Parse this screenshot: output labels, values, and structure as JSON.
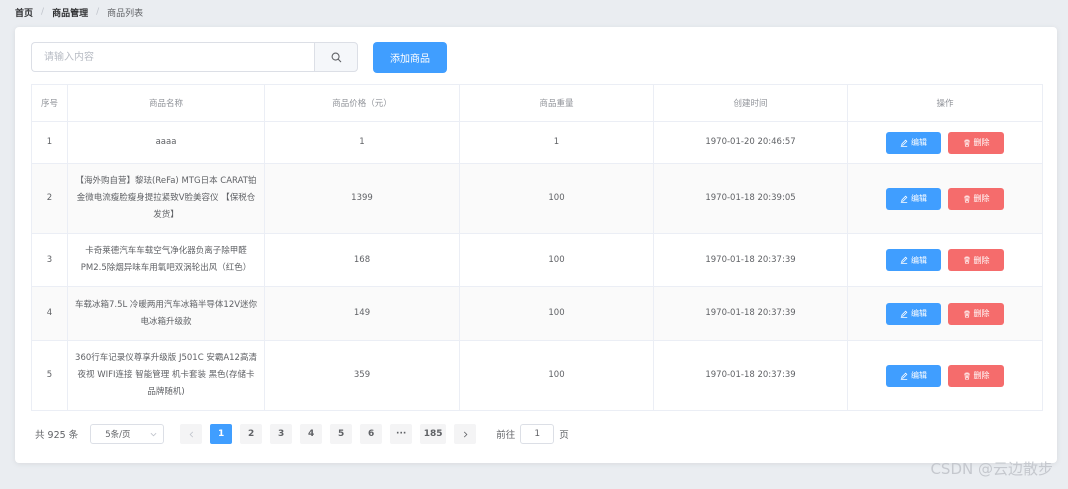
{
  "breadcrumb": {
    "home": "首页",
    "section": "商品管理",
    "current": "商品列表",
    "separator": "/"
  },
  "search": {
    "placeholder": "请输入内容",
    "value": "",
    "icon": "search-icon"
  },
  "toolbar": {
    "add_label": "添加商品"
  },
  "table": {
    "headers": [
      "序号",
      "商品名称",
      "商品价格（元）",
      "商品重量",
      "创建时间",
      "操作"
    ],
    "rows": [
      {
        "index": "1",
        "name": "aaaa",
        "price": "1",
        "weight": "1",
        "created": "1970-01-20 20:46:57"
      },
      {
        "index": "2",
        "name": "【海外购自营】黎珐(ReFa) MTG日本 CARAT铂金微电流瘦脸瘦身提拉紧致V脸美容仪 【保税仓发货】",
        "price": "1399",
        "weight": "100",
        "created": "1970-01-18 20:39:05"
      },
      {
        "index": "3",
        "name": "卡奇莱德汽车车载空气净化器负离子除甲醛PM2.5除烟异味车用氧吧双涡轮出风（红色）",
        "price": "168",
        "weight": "100",
        "created": "1970-01-18 20:37:39"
      },
      {
        "index": "4",
        "name": "车载冰箱7.5L 冷暖两用汽车冰箱半导体12V迷你电冰箱升级款",
        "price": "149",
        "weight": "100",
        "created": "1970-01-18 20:37:39"
      },
      {
        "index": "5",
        "name": "360行车记录仪尊享升级版 J501C 安霸A12高清夜视 WIFI连接 智能管理 机卡套装 黑色(存储卡品牌随机)",
        "price": "359",
        "weight": "100",
        "created": "1970-01-18 20:37:39"
      }
    ],
    "edit_label": "编辑",
    "delete_label": "删除"
  },
  "pagination": {
    "total_text": "共 925 条",
    "page_size": "5条/页",
    "pages": [
      "1",
      "2",
      "3",
      "4",
      "5",
      "6",
      "···",
      "185"
    ],
    "current_page": "1",
    "goto_prefix": "前往",
    "goto_value": "1",
    "goto_suffix": "页"
  },
  "watermark": "CSDN @云边散步",
  "colors": {
    "primary": "#409eff",
    "danger": "#f56c6c",
    "background": "#eaedf1"
  }
}
